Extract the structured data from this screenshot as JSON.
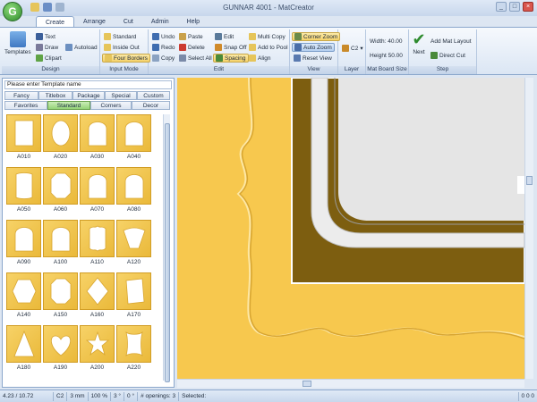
{
  "window": {
    "title": "GUNNAR 4001 - MatCreator",
    "app_initial": "G"
  },
  "tabs": [
    "Create",
    "Arrange",
    "Cut",
    "Admin",
    "Help"
  ],
  "ribbon": {
    "design": {
      "label": "Design",
      "templates": "Templates",
      "text": "Text",
      "draw": "Draw",
      "clipart": "Clipart",
      "autoload": "Autoload"
    },
    "input_mode": {
      "label": "Input Mode",
      "standard": "Standard",
      "inside_out": "Inside Out",
      "four_borders": "Four Borders"
    },
    "edit": {
      "label": "Edit",
      "undo": "Undo",
      "redo": "Redo",
      "copy": "Copy",
      "paste": "Paste",
      "delete": "Delete",
      "select_all": "Select All",
      "edit": "Edit",
      "snap_off": "Snap Off",
      "spacing": "Spacing",
      "multi_copy": "Multi Copy",
      "add_to_pool": "Add to Pool",
      "align": "Align"
    },
    "view": {
      "label": "View",
      "corner_zoom": "Corner Zoom",
      "auto_zoom": "Auto Zoom",
      "reset_view": "Reset View"
    },
    "layer": {
      "label": "Layer",
      "value": "C2"
    },
    "mat_board_size": {
      "label": "Mat Board Size",
      "width": "Width: 40.00",
      "height": "Height 50.00"
    },
    "step": {
      "label": "Step",
      "next": "Next",
      "add_mat_layout": "Add Mat Layout",
      "direct_cut": "Direct Cut"
    }
  },
  "template_panel": {
    "search_placeholder": "Please enter Template name",
    "category_tabs_row1": [
      "Fancy",
      "Titlebox",
      "Package",
      "Special",
      "Custom"
    ],
    "category_tabs_row2": [
      "Favorites",
      "Standard",
      "Corners",
      "Decor"
    ],
    "templates": [
      "A010",
      "A020",
      "A030",
      "A040",
      "A050",
      "A060",
      "A070",
      "A080",
      "A090",
      "A100",
      "A110",
      "A120",
      "A140",
      "A150",
      "A160",
      "A170",
      "A180",
      "A190",
      "A200",
      "A220"
    ]
  },
  "status": {
    "coords": "4.23 / 10.72",
    "layer": "C2",
    "size": "3 mm",
    "zoom": "100 %",
    "angle1": "3 °",
    "angle2": "0 °",
    "openings": "# openings:  3",
    "selected": "Selected:",
    "right": "0 0 0"
  },
  "colors": {
    "mat": "#f7c84e",
    "bevel_dark": "#7d5e10",
    "accent_green": "#6aa24e"
  }
}
